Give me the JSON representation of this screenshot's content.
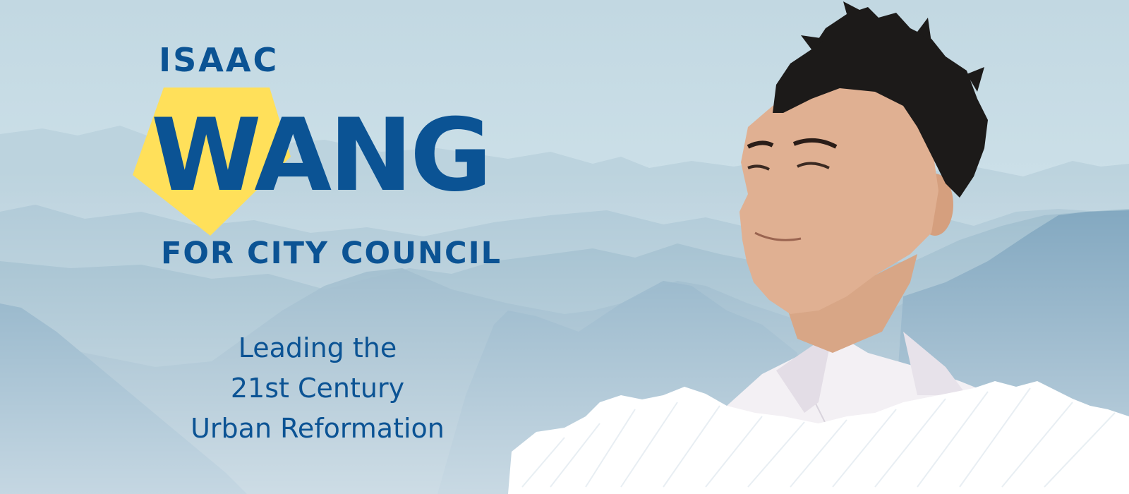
{
  "candidate": {
    "first_name": "ISAAC",
    "surname": "WANG",
    "office": "FOR CITY COUNCIL"
  },
  "tagline": {
    "line1": "Leading the",
    "line2": "21st Century",
    "line3": "Urban Reformation"
  },
  "colors": {
    "brand_blue": "#0b5394",
    "brand_yellow": "#ffe05a",
    "sky": "#c9dde6"
  },
  "imagery": {
    "background": "misty-mountain-range",
    "portrait": "candidate-portrait",
    "foreground": "white-cloud-scribble"
  }
}
